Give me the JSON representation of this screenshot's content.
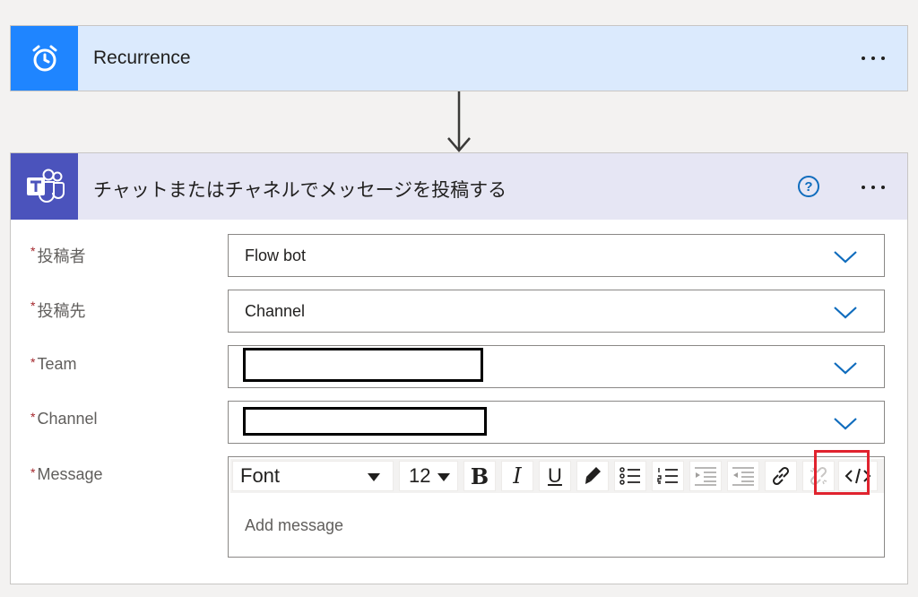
{
  "recurrence": {
    "title": "Recurrence",
    "icon": "alarm-clock-icon",
    "accent": "#1f85ff"
  },
  "teams_action": {
    "title": "チャットまたはチャネルでメッセージを投稿する",
    "icon": "teams-icon",
    "accent": "#4b53bc",
    "help_label": "?",
    "fields": [
      {
        "label": "投稿者",
        "value": "Flow bot"
      },
      {
        "label": "投稿先",
        "value": "Channel"
      },
      {
        "label": "Team",
        "value": ""
      },
      {
        "label": "Channel",
        "value": ""
      }
    ],
    "message": {
      "label": "Message",
      "placeholder": "Add message",
      "toolbar": {
        "font": "Font",
        "size": "12",
        "bold": "B",
        "italic": "I",
        "underline": "U",
        "highlighted_button": "code-view-button",
        "highlight_color": "#e0232e"
      }
    }
  },
  "required_mark": "*"
}
